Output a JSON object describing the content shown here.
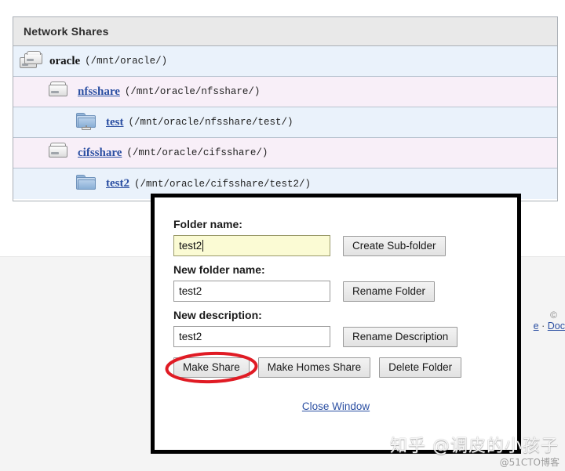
{
  "panel": {
    "title": "Network Shares",
    "rows": [
      {
        "icon": "disk-stack-icon",
        "name": "oracle",
        "name_is_link": false,
        "path": "(/mnt/oracle/)",
        "indent": 0,
        "tone": "blue"
      },
      {
        "icon": "disk-icon",
        "name": "nfsshare",
        "name_is_link": true,
        "path": "(/mnt/oracle/nfsshare/)",
        "indent": 1,
        "tone": "pink"
      },
      {
        "icon": "network-folder-icon",
        "name": "test",
        "name_is_link": true,
        "path": "(/mnt/oracle/nfsshare/test/)",
        "indent": 2,
        "tone": "blue"
      },
      {
        "icon": "disk-icon",
        "name": "cifsshare",
        "name_is_link": true,
        "path": "(/mnt/oracle/cifsshare/)",
        "indent": 1,
        "tone": "pink"
      },
      {
        "icon": "folder-icon",
        "name": "test2",
        "name_is_link": true,
        "path": "(/mnt/oracle/cifsshare/test2/)",
        "indent": 2,
        "tone": "blue"
      }
    ]
  },
  "footer_partial": {
    "copyright_symbol": "©",
    "link_left_fragment": "e",
    "separator": "·",
    "link_right_fragment": "Doc"
  },
  "dialog": {
    "folder_name_label": "Folder name:",
    "folder_name_value": "test2",
    "create_subfolder_label": "Create Sub-folder",
    "new_folder_name_label": "New folder name:",
    "new_folder_name_value": "test2",
    "rename_folder_label": "Rename Folder",
    "new_description_label": "New description:",
    "new_description_value": "test2",
    "rename_description_label": "Rename Description",
    "make_share_label": "Make Share",
    "make_homes_share_label": "Make Homes Share",
    "delete_folder_label": "Delete Folder",
    "close_window_label": "Close Window"
  },
  "annotation": {
    "highlight_color": "#e01b24",
    "highlight_target": "Make Share"
  },
  "watermarks": {
    "zhihu": "知乎 @调皮的小孩子",
    "blog": "@51CTO博客"
  }
}
